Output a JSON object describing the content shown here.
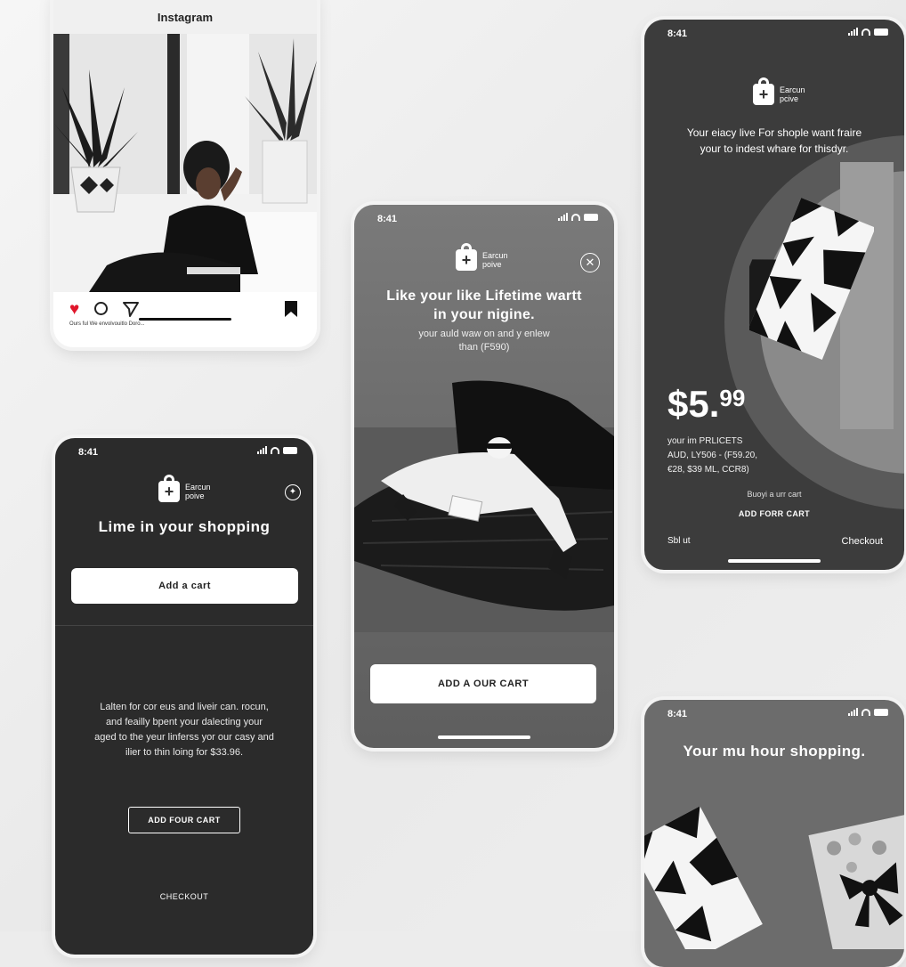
{
  "instagram": {
    "title": "Instagram",
    "caption": "Ours ful  We envolvouitlo Doro..."
  },
  "screen_dark": {
    "time": "8:41",
    "brand": "Earcun\npoive",
    "headline": "Lime in your shopping",
    "add_button": "Add a cart",
    "body": "Lalten for cor eus and liveir can. rocun, and feailly bpent your dalecting your aged to the yeur linferss yor our casy and ilier to thin loing for $33.96.",
    "add_outline_button": "ADD FOUR CART",
    "checkout_link": "CHECKOUT"
  },
  "screen_center": {
    "time": "8:41",
    "brand": "Earcun\npoive",
    "headline": "Like your like Lifetime wartt in your nigine.",
    "subtext": "your auld waw on and y enlew than (F590)",
    "cta": "ADD A OUR CART"
  },
  "screen_right_top": {
    "time": "8:41",
    "brand": "Earcun\npcive",
    "headline": "Your eiacy live For shople want fraire your to indest whare for thisdyr.",
    "price_main": "$5.",
    "price_cents": "99",
    "price_note": "your im PRLICETS\nAUD, LY506 - (F59.20,\n€28, $39 ML, CCR8)",
    "subnote": "Buoyi a urr cart",
    "add_link": "ADD FORR CART",
    "left_link": "Sbl ut",
    "right_link": "Checkout"
  },
  "screen_right_bottom": {
    "time": "8:41",
    "headline": "Your mu hour shopping."
  },
  "colors": {
    "dark_bg": "#2b2b2b",
    "gray_bg": "#6d6d6d",
    "heart": "#e0162b"
  }
}
